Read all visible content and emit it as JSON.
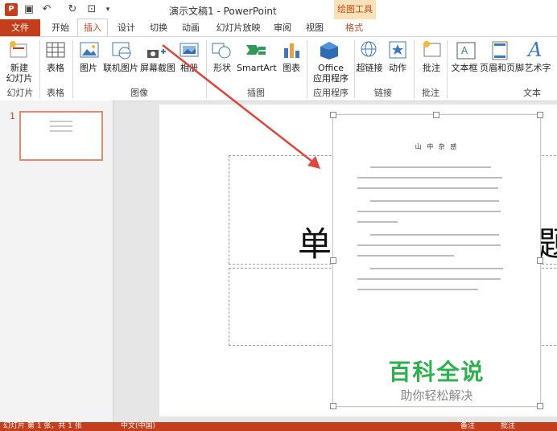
{
  "title_bar": {
    "document_title": "演示文稿1 - PowerPoint",
    "context_tools": "绘图工具",
    "app_logo": "P"
  },
  "tabs": {
    "file": "文件",
    "items": [
      "开始",
      "插入",
      "设计",
      "切换",
      "动画",
      "幻灯片放映",
      "审阅",
      "视图",
      "格式"
    ],
    "active": "插入"
  },
  "ribbon": {
    "new_slide": [
      "新建",
      "幻灯片"
    ],
    "table": "表格",
    "picture": "图片",
    "online_picture": "联机图片",
    "screenshot": "屏幕截图",
    "album": "相册",
    "shapes": "形状",
    "smartart": "SmartArt",
    "chart": "图表",
    "office_apps": [
      "Office",
      "应用程序"
    ],
    "hyperlink": "超链接",
    "action": "动作",
    "comment": "批注",
    "textbox": "文本框",
    "header_footer": "页眉和页脚",
    "wordart": "艺术字",
    "groups": [
      "幻灯片",
      "表格",
      "图像",
      "插图",
      "应用程序",
      "链接",
      "批注",
      "文本"
    ]
  },
  "slide_panel": {
    "number": "1"
  },
  "slide": {
    "title_char_left": "单",
    "title_char_right": "题"
  },
  "inserted_image": {
    "heading": "山 中 杂 感",
    "watermark_title": "百科全说",
    "watermark_subtitle": "助你轻松解决"
  },
  "status_bar": {
    "slide_info": "幻灯片 第 1 张，共 1 张",
    "language": "中文(中国)",
    "notes": "备注",
    "comments": "批注"
  },
  "colors": {
    "accent": "#c43e1c",
    "arrow": "#e0453a",
    "watermark_green": "#2bb24c"
  }
}
